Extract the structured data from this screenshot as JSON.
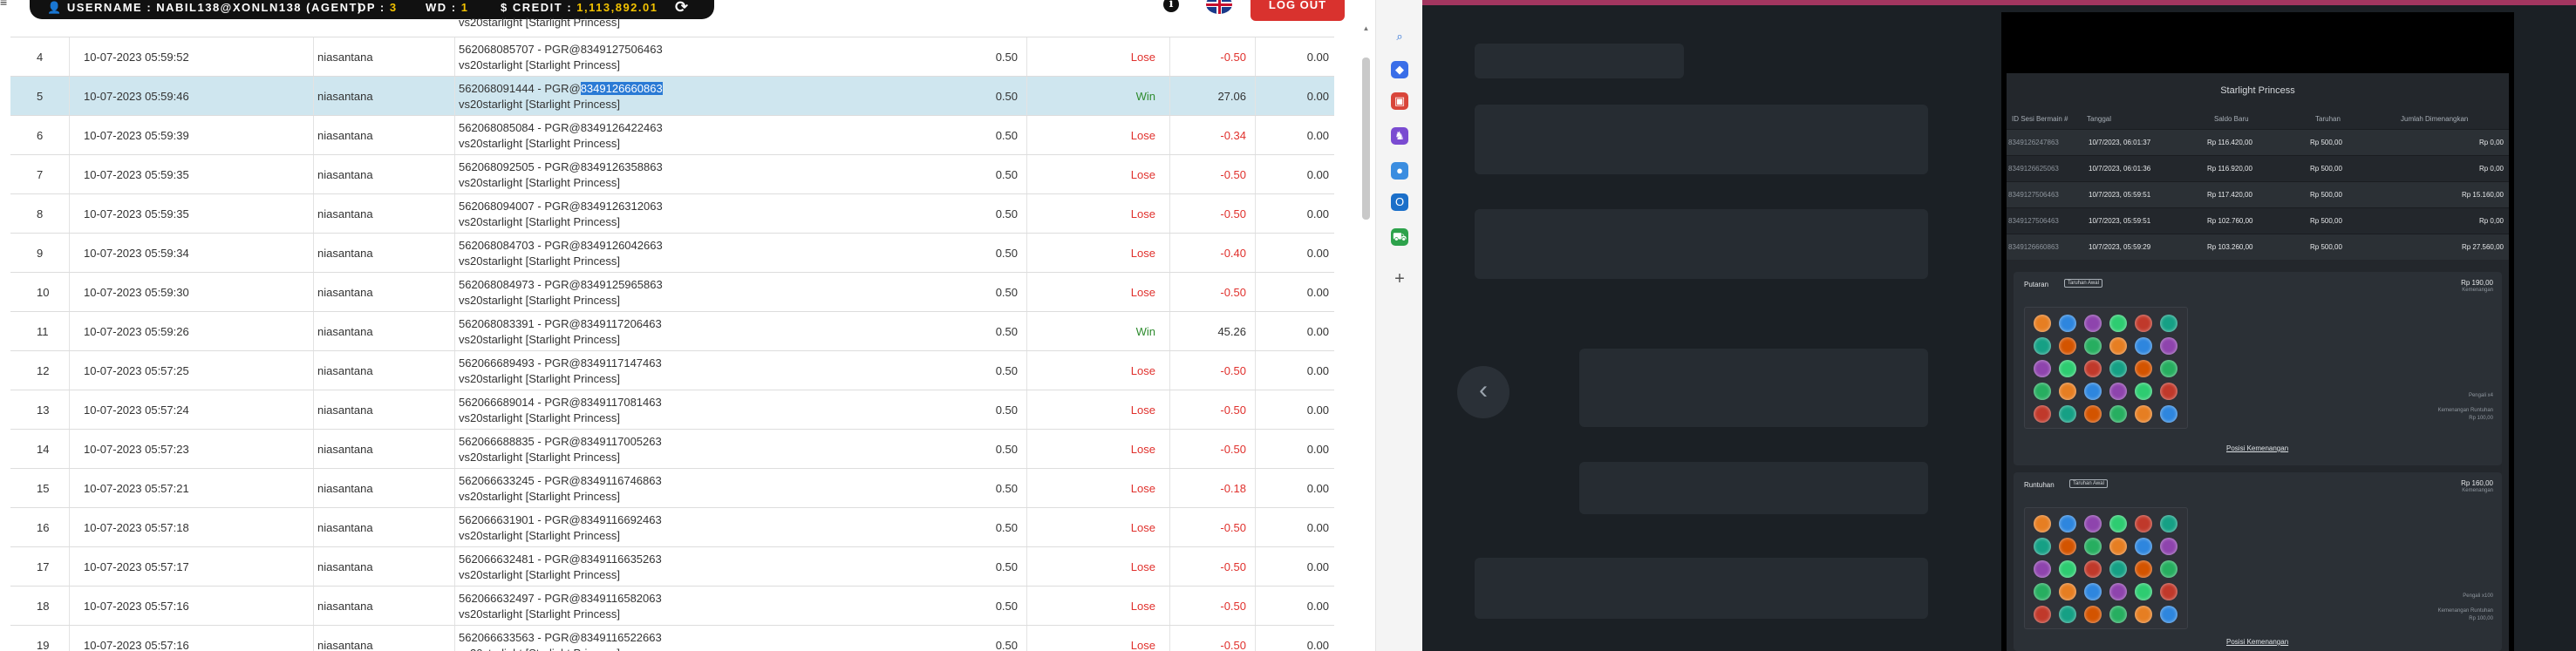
{
  "topbar": {
    "username_label": "USERNAME : ",
    "username_value": "NABIL138@XONLN138 (AGENT)",
    "dp_label": "DP : ",
    "dp_value": "3",
    "wd_label": "WD : ",
    "wd_value": "1",
    "credit_label": "$ CREDIT : ",
    "credit_value": "1,113,892.01",
    "info_symbol": "i",
    "logout_label": "LOG OUT"
  },
  "partial_top_row": {
    "game_line": "vs20starlight [Starlight Princess]"
  },
  "rows": [
    {
      "no": "4",
      "date": "10-07-2023 05:59:52",
      "user": "niasantana",
      "id_prefix": "562068085707 - PGR@",
      "id_suffix": "8349127506463",
      "game": "vs20starlight [Starlight Princess]",
      "bet": "0.50",
      "result": "Lose",
      "winloss": "-0.50",
      "total": "0.00"
    },
    {
      "no": "5",
      "date": "10-07-2023 05:59:46",
      "user": "niasantana",
      "id_prefix": "562068091444 - PGR@",
      "id_suffix": "8349126660863",
      "game": "vs20starlight [Starlight Princess]",
      "bet": "0.50",
      "result": "Win",
      "winloss": "27.06",
      "total": "0.00"
    },
    {
      "no": "6",
      "date": "10-07-2023 05:59:39",
      "user": "niasantana",
      "id_prefix": "562068085084 - PGR@",
      "id_suffix": "8349126422463",
      "game": "vs20starlight [Starlight Princess]",
      "bet": "0.50",
      "result": "Lose",
      "winloss": "-0.34",
      "total": "0.00"
    },
    {
      "no": "7",
      "date": "10-07-2023 05:59:35",
      "user": "niasantana",
      "id_prefix": "562068092505 - PGR@",
      "id_suffix": "8349126358863",
      "game": "vs20starlight [Starlight Princess]",
      "bet": "0.50",
      "result": "Lose",
      "winloss": "-0.50",
      "total": "0.00"
    },
    {
      "no": "8",
      "date": "10-07-2023 05:59:35",
      "user": "niasantana",
      "id_prefix": "562068094007 - PGR@",
      "id_suffix": "8349126312063",
      "game": "vs20starlight [Starlight Princess]",
      "bet": "0.50",
      "result": "Lose",
      "winloss": "-0.50",
      "total": "0.00"
    },
    {
      "no": "9",
      "date": "10-07-2023 05:59:34",
      "user": "niasantana",
      "id_prefix": "562068084703 - PGR@",
      "id_suffix": "8349126042663",
      "game": "vs20starlight [Starlight Princess]",
      "bet": "0.50",
      "result": "Lose",
      "winloss": "-0.40",
      "total": "0.00"
    },
    {
      "no": "10",
      "date": "10-07-2023 05:59:30",
      "user": "niasantana",
      "id_prefix": "562068084973 - PGR@",
      "id_suffix": "8349125965863",
      "game": "vs20starlight [Starlight Princess]",
      "bet": "0.50",
      "result": "Lose",
      "winloss": "-0.50",
      "total": "0.00"
    },
    {
      "no": "11",
      "date": "10-07-2023 05:59:26",
      "user": "niasantana",
      "id_prefix": "562068083391 - PGR@",
      "id_suffix": "8349117206463",
      "game": "vs20starlight [Starlight Princess]",
      "bet": "0.50",
      "result": "Win",
      "winloss": "45.26",
      "total": "0.00"
    },
    {
      "no": "12",
      "date": "10-07-2023 05:57:25",
      "user": "niasantana",
      "id_prefix": "562066689493 - PGR@",
      "id_suffix": "8349117147463",
      "game": "vs20starlight [Starlight Princess]",
      "bet": "0.50",
      "result": "Lose",
      "winloss": "-0.50",
      "total": "0.00"
    },
    {
      "no": "13",
      "date": "10-07-2023 05:57:24",
      "user": "niasantana",
      "id_prefix": "562066689014 - PGR@",
      "id_suffix": "8349117081463",
      "game": "vs20starlight [Starlight Princess]",
      "bet": "0.50",
      "result": "Lose",
      "winloss": "-0.50",
      "total": "0.00"
    },
    {
      "no": "14",
      "date": "10-07-2023 05:57:23",
      "user": "niasantana",
      "id_prefix": "562066688835 - PGR@",
      "id_suffix": "8349117005263",
      "game": "vs20starlight [Starlight Princess]",
      "bet": "0.50",
      "result": "Lose",
      "winloss": "-0.50",
      "total": "0.00"
    },
    {
      "no": "15",
      "date": "10-07-2023 05:57:21",
      "user": "niasantana",
      "id_prefix": "562066633245 - PGR@",
      "id_suffix": "8349116746863",
      "game": "vs20starlight [Starlight Princess]",
      "bet": "0.50",
      "result": "Lose",
      "winloss": "-0.18",
      "total": "0.00"
    },
    {
      "no": "16",
      "date": "10-07-2023 05:57:18",
      "user": "niasantana",
      "id_prefix": "562066631901 - PGR@",
      "id_suffix": "8349116692463",
      "game": "vs20starlight [Starlight Princess]",
      "bet": "0.50",
      "result": "Lose",
      "winloss": "-0.50",
      "total": "0.00"
    },
    {
      "no": "17",
      "date": "10-07-2023 05:57:17",
      "user": "niasantana",
      "id_prefix": "562066632481 - PGR@",
      "id_suffix": "8349116635263",
      "game": "vs20starlight [Starlight Princess]",
      "bet": "0.50",
      "result": "Lose",
      "winloss": "-0.50",
      "total": "0.00"
    },
    {
      "no": "18",
      "date": "10-07-2023 05:57:16",
      "user": "niasantana",
      "id_prefix": "562066632497 - PGR@",
      "id_suffix": "8349116582063",
      "game": "vs20starlight [Starlight Princess]",
      "bet": "0.50",
      "result": "Lose",
      "winloss": "-0.50",
      "total": "0.00"
    },
    {
      "no": "19",
      "date": "10-07-2023 05:57:16",
      "user": "niasantana",
      "id_prefix": "562066633563 - PGR@",
      "id_suffix": "8349116522663",
      "game": "vs20starlight [Starlight Princess]",
      "bet": "0.50",
      "result": "Lose",
      "winloss": "-0.50",
      "total": "0.00"
    }
  ],
  "selected_row": "5",
  "side_icons": [
    {
      "name": "search-icon",
      "glyph": "⌕",
      "color": "#2a6fd6"
    },
    {
      "name": "tag-icon",
      "glyph": "◆",
      "color": "#3a6ee8"
    },
    {
      "name": "toolbox-icon",
      "glyph": "▣",
      "color": "#d9453a"
    },
    {
      "name": "chess-icon",
      "glyph": "♞",
      "color": "#7a4bd1"
    },
    {
      "name": "copilot-icon",
      "glyph": "●",
      "color": "#3b8de0"
    },
    {
      "name": "outlook-icon",
      "glyph": "O",
      "color": "#1b6fc9"
    },
    {
      "name": "cart-icon",
      "glyph": "⛟",
      "color": "#2da24b"
    },
    {
      "name": "add-icon",
      "glyph": "+",
      "color": "#555555"
    }
  ],
  "modal": {
    "title": "Starlight Princess",
    "headers": {
      "id": "ID Sesi Bermain #",
      "date": "Tanggal",
      "balance": "Saldo Baru",
      "bet": "Taruhan",
      "win": "Jumlah Dimenangkan"
    },
    "rows": [
      {
        "id": "8349126247863",
        "date": "10/7/2023, 06:01:37",
        "balance": "Rp 116.420,00",
        "bet": "Rp 500,00",
        "win": "Rp 0,00"
      },
      {
        "id": "8349126625063",
        "date": "10/7/2023, 06:01:36",
        "balance": "Rp 116.920,00",
        "bet": "Rp 500,00",
        "win": "Rp 0,00"
      },
      {
        "id": "8349127506463",
        "date": "10/7/2023, 05:59:51",
        "balance": "Rp 117.420,00",
        "bet": "Rp 500,00",
        "win": "Rp 15.160,00"
      },
      {
        "id": "8349127506463",
        "date": "10/7/2023, 05:59:51",
        "balance": "Rp 102.760,00",
        "bet": "Rp 500,00",
        "win": "Rp 0,00"
      },
      {
        "id": "8349126660863",
        "date": "10/7/2023, 05:59:29",
        "balance": "Rp 103.260,00",
        "bet": "Rp 500,00",
        "win": "Rp 27.560,00"
      }
    ],
    "card1": {
      "label": "Putaran",
      "badge": "Taruhan Awal",
      "amount": "Rp 190,00",
      "amount_sub": "Kemenangan",
      "info1": "Pengali x4",
      "info2": "Kemenangan Runtuhan",
      "info3": "Rp 100,00",
      "link": "Posisi Kemenangan"
    },
    "card2": {
      "label": "Runtuhan",
      "badge": "Taruhan Awal",
      "amount": "Rp 160,00",
      "amount_sub": "Kemenangan",
      "info1": "Pengali x100",
      "info2": "Kemenangan Runtuhan",
      "info3": "Rp 100,00",
      "link": "Posisi Kemenangan"
    }
  },
  "colors": {
    "lose": "#e0302c",
    "win": "#2e8b2e",
    "selected_row": "#cfe6ef",
    "logout": "#d9322e",
    "credit": "#f2c200",
    "right_topline": "#a33660"
  }
}
